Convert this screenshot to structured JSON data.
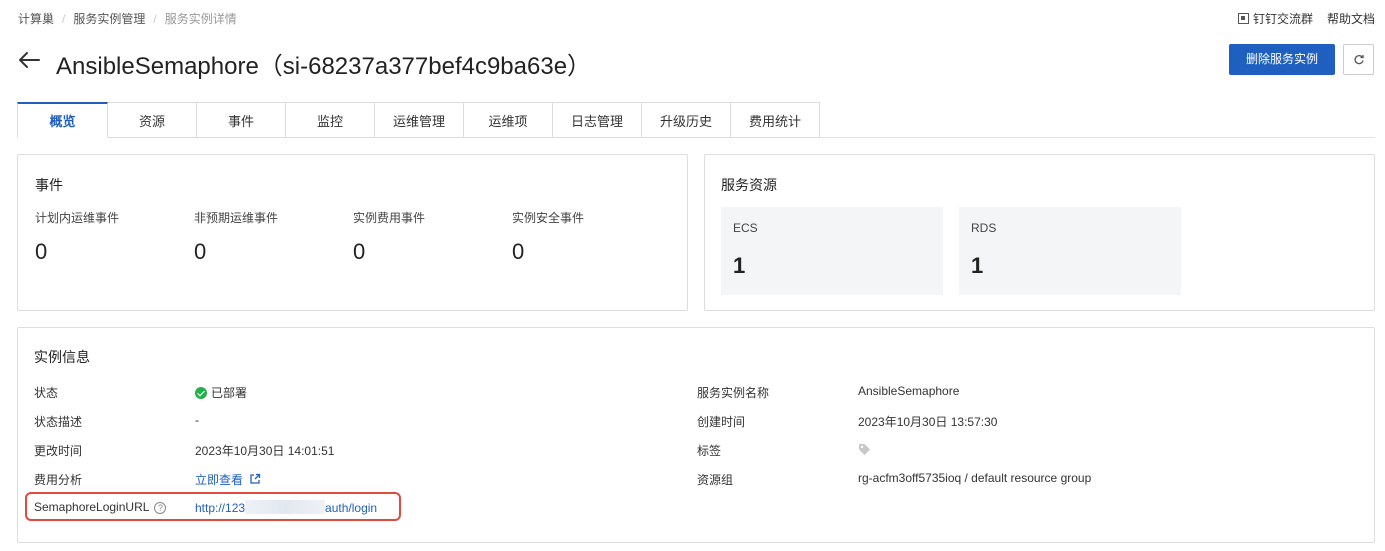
{
  "breadcrumb": [
    "计算巢",
    "服务实例管理",
    "服务实例详情"
  ],
  "top_links": {
    "dingtalk": "钉钉交流群",
    "help": "帮助文档"
  },
  "page_title": "AnsibleSemaphore（si-68237a377bef4c9ba63e）",
  "actions": {
    "delete_label": "删除服务实例"
  },
  "tabs": [
    "概览",
    "资源",
    "事件",
    "监控",
    "运维管理",
    "运维项",
    "日志管理",
    "升级历史",
    "费用统计"
  ],
  "events": {
    "title": "事件",
    "items": [
      {
        "label": "计划内运维事件",
        "value": "0"
      },
      {
        "label": "非预期运维事件",
        "value": "0"
      },
      {
        "label": "实例费用事件",
        "value": "0"
      },
      {
        "label": "实例安全事件",
        "value": "0"
      }
    ]
  },
  "resources": {
    "title": "服务资源",
    "items": [
      {
        "label": "ECS",
        "value": "1"
      },
      {
        "label": "RDS",
        "value": "1"
      }
    ]
  },
  "instance_info": {
    "title": "实例信息",
    "status": {
      "label": "状态",
      "value": "已部署"
    },
    "status_desc": {
      "label": "状态描述",
      "value": "-"
    },
    "updated": {
      "label": "更改时间",
      "value": "2023年10月30日 14:01:51"
    },
    "cost": {
      "label": "费用分析",
      "value": "立即查看"
    },
    "login_url": {
      "label": "SemaphoreLoginURL",
      "value_prefix": "http://123",
      "value_suffix": "auth/login"
    },
    "name": {
      "label": "服务实例名称",
      "value": "AnsibleSemaphore"
    },
    "created": {
      "label": "创建时间",
      "value": "2023年10月30日 13:57:30"
    },
    "tags": {
      "label": "标签"
    },
    "resource_group": {
      "label": "资源组",
      "value": "rg-acfm3off5735ioq / default resource group"
    }
  },
  "colors": {
    "primary": "#1f5fbf",
    "success": "#23b04a",
    "highlight": "#e24a3b"
  }
}
